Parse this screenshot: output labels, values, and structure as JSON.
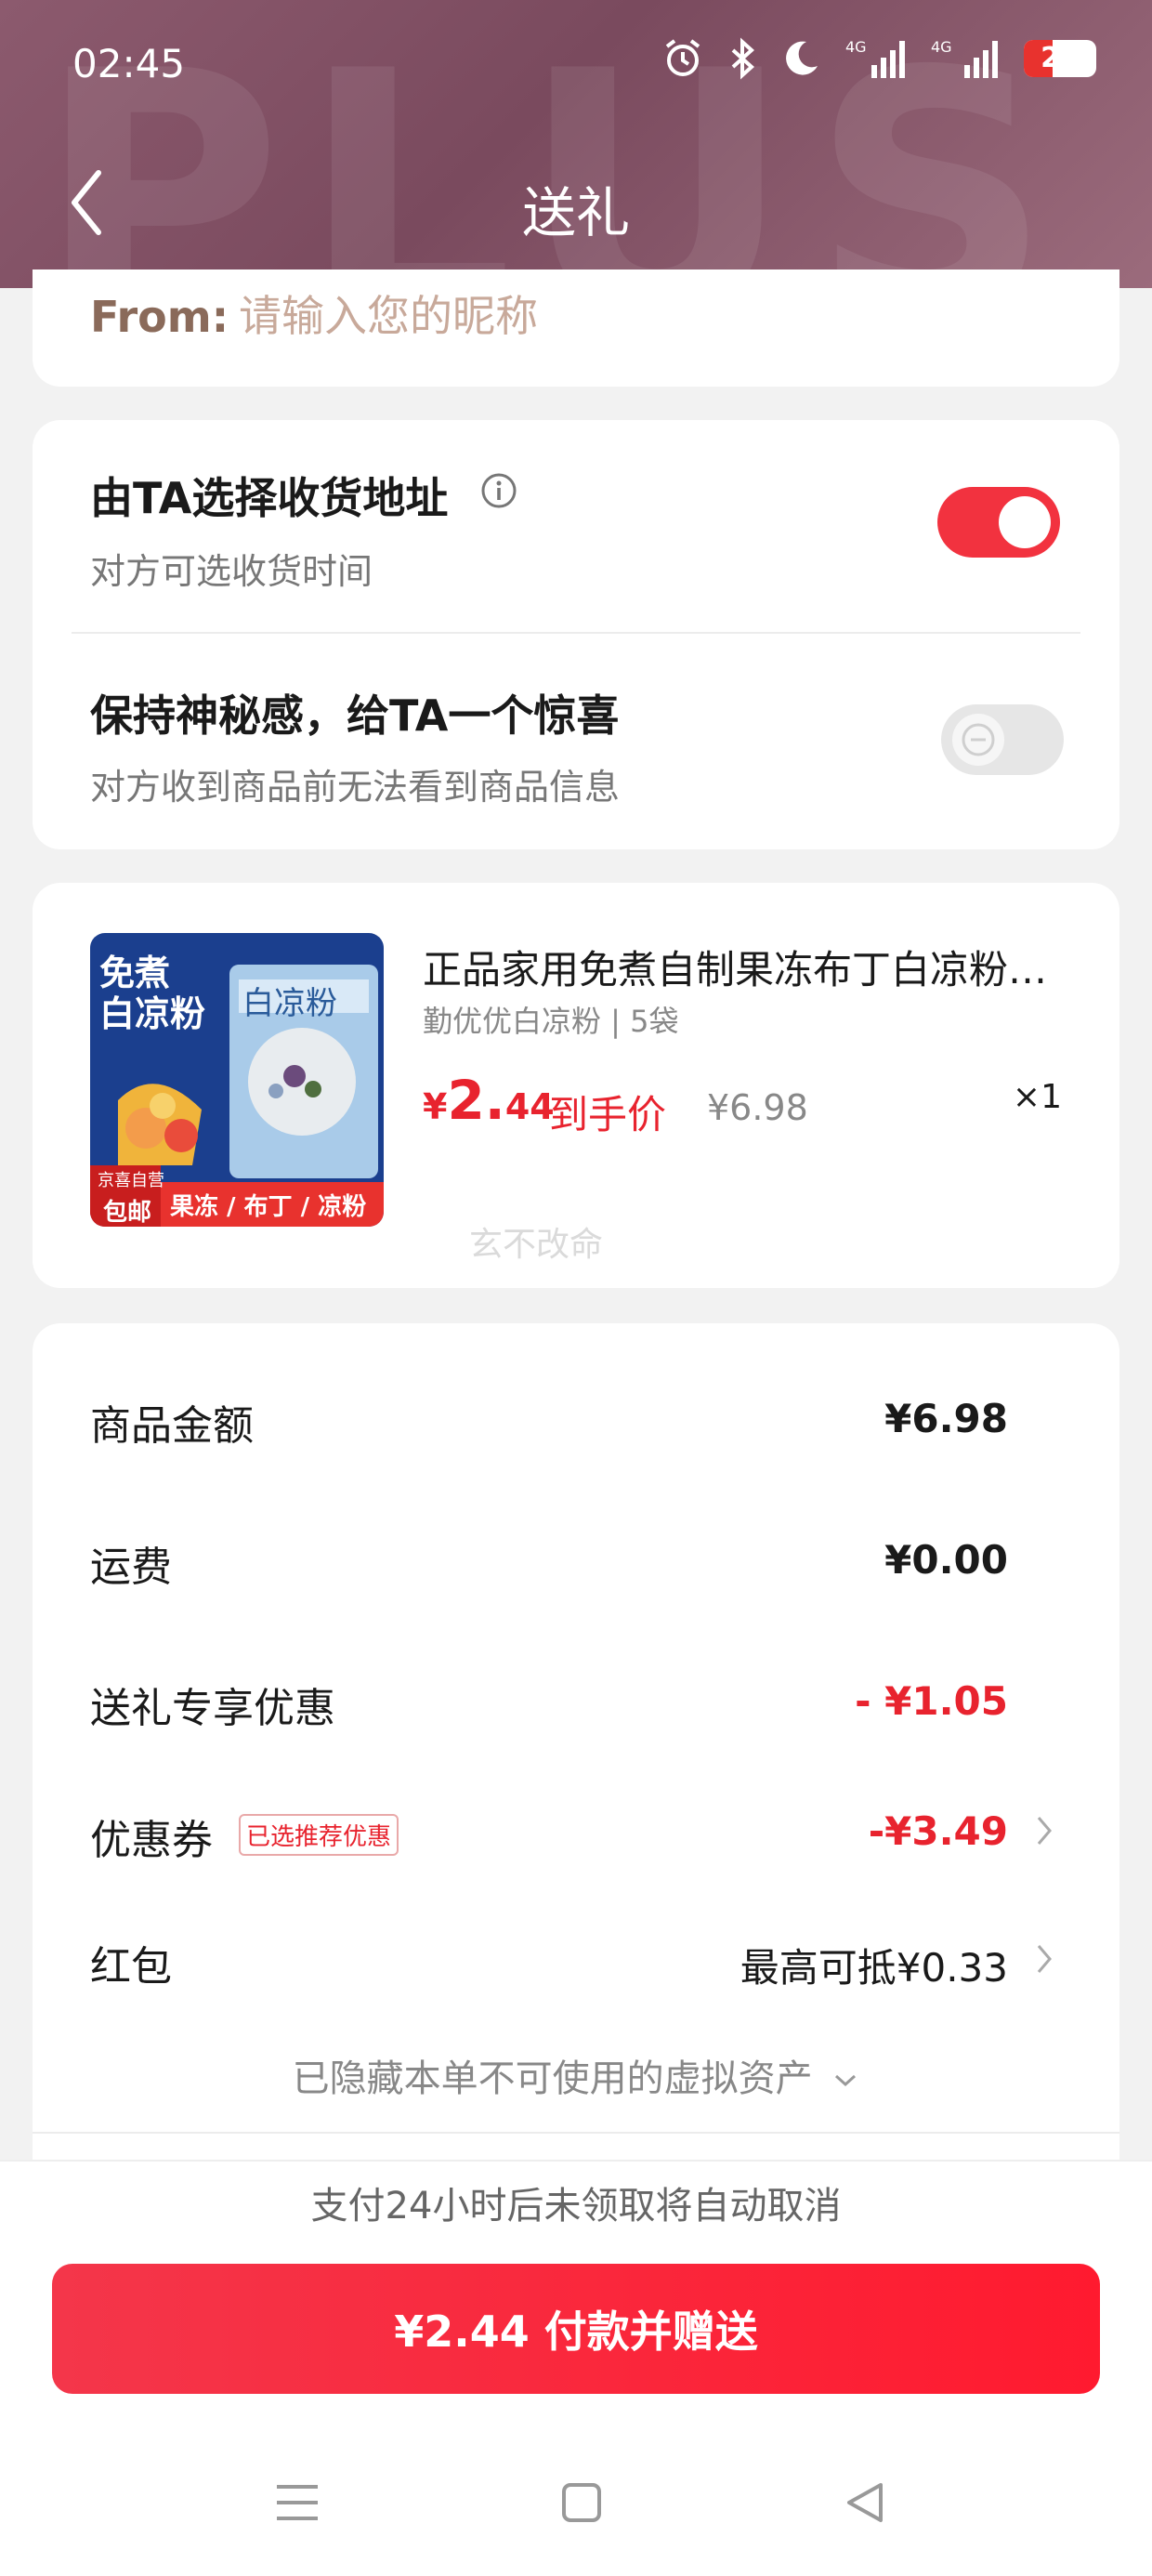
{
  "status_bar": {
    "time": "02:45",
    "battery": "20",
    "network": "4G"
  },
  "header": {
    "bg_text": "PLUS",
    "title": "送礼"
  },
  "sender": {
    "label": "From:",
    "placeholder": "请输入您的昵称"
  },
  "options": [
    {
      "title": "由TA选择收货地址",
      "subtitle": "对方可选收货时间",
      "enabled": true
    },
    {
      "title": "保持神秘感，给TA一个惊喜",
      "subtitle": "对方收到商品前无法看到商品信息",
      "enabled": false
    }
  ],
  "product": {
    "name": "正品家用免煮自制果冻布丁白凉粉家用...",
    "spec": "勤优优白凉粉 | 5袋",
    "price_symbol": "¥",
    "price_int": "2.",
    "price_dec": "44",
    "price_tag": "到手价",
    "original_price": "¥6.98",
    "quantity": "×1",
    "image": {
      "line1": "免煮",
      "line2": "白凉粉",
      "pack_text": "白凉粉",
      "banner": "果冻 / 布丁 / 凉粉",
      "badge1": "京喜自营",
      "badge2": "包邮"
    },
    "watermark": "玄不改命"
  },
  "summary": [
    {
      "label": "商品金额",
      "value": "¥6.98"
    },
    {
      "label": "运费",
      "value": "¥0.00"
    },
    {
      "label": "送礼专享优惠",
      "value": "- ¥1.05"
    },
    {
      "label": "优惠券",
      "badge": "已选推荐优惠",
      "value": "-¥3.49"
    },
    {
      "label": "红包",
      "value": "最高可抵¥0.33"
    }
  ],
  "hidden_assets": "已隐藏本单不可使用的虚拟资产",
  "notice": "支付24小时后未领取将自动取消",
  "pay_button": "¥2.44 付款并赠送",
  "colors": {
    "accent": "#e8232e",
    "button": "#f4364a",
    "header": "#8c5a6e"
  }
}
